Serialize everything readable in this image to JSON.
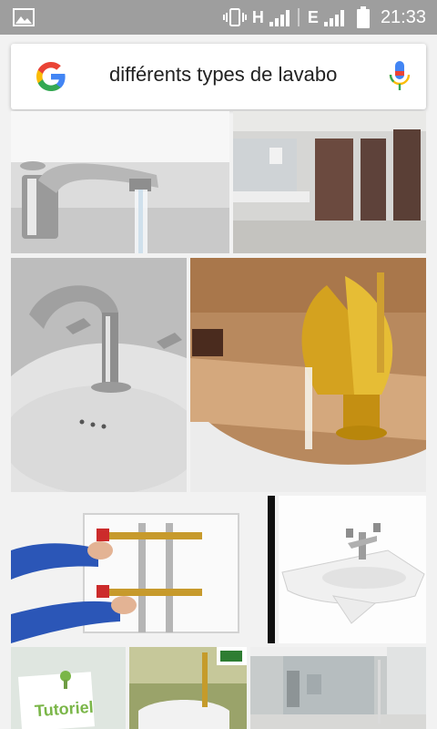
{
  "status": {
    "network_label_1": "H",
    "network_label_2": "E",
    "time": "21:33"
  },
  "search": {
    "query": "différents types de lavabo",
    "icons": [
      "google-logo-icon",
      "microphone-icon"
    ]
  },
  "results": [
    {
      "caption": ""
    },
    {
      "caption": ""
    },
    {
      "caption": ""
    },
    {
      "caption": ""
    },
    {
      "caption": ""
    },
    {
      "caption": ""
    },
    {
      "caption": "Tutoriel"
    },
    {
      "caption": ""
    },
    {
      "caption": ""
    }
  ],
  "colors": {
    "status_bar": "#9e9e9e",
    "google_blue": "#4285f4",
    "google_red": "#ea4335",
    "google_yellow": "#fbbc05",
    "google_green": "#34a853",
    "tutoriel_green": "#7ab648"
  }
}
